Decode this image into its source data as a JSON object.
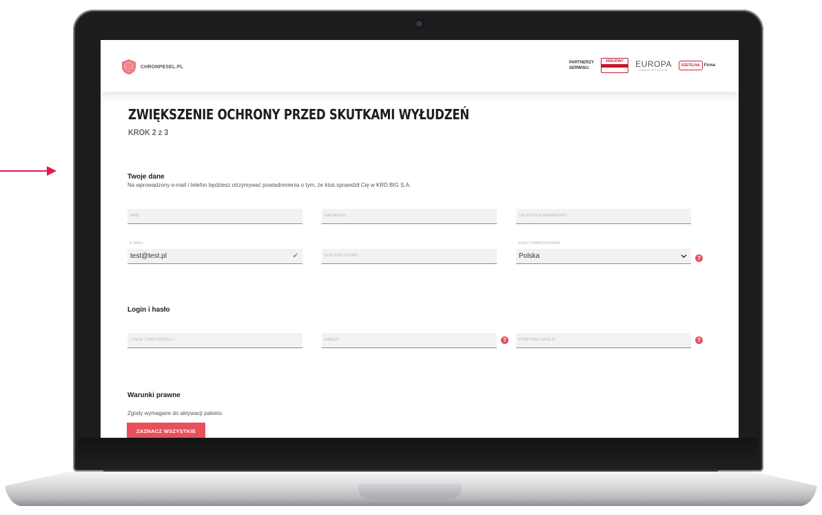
{
  "brand": {
    "name": "CHRONPESEL.PL"
  },
  "partners": {
    "label_line1": "PARTNERZY",
    "label_line2": "SERWISU:",
    "krajowy_top": "KRAJOWY",
    "europa_text": "EUROPA",
    "europa_sub": "UBEZPIECZENIA",
    "rzetelna_text": "RZETELNA",
    "firma_text": "Firma"
  },
  "page": {
    "title": "ZWIĘKSZENIE OCHRONY PRZED SKUTKAMI WYŁUDZEŃ",
    "step": "KROK 2 z 3"
  },
  "personal": {
    "title": "Twoje dane",
    "note": "Na wprowadzony e-mail i telefon będziesz otrzymywać powiadomienia o tym, że ktoś sprawdził Cię w KRD BIG S.A.",
    "first_name_placeholder": "IMIĘ:",
    "last_name_placeholder": "NAZWISKO:",
    "phone_placeholder": "TELEFON KOMÓRKOWY:",
    "email_label": "E-MAIL:",
    "email_value": "test@test.pl",
    "postal_placeholder": "KOD POCZTOWY:",
    "country_label": "KRAJ ZAMIESZKANIA:",
    "country_value": "Polska"
  },
  "login": {
    "title": "Login i hasło",
    "login_placeholder": "LOGIN (TWÓJ PESEL):",
    "password_placeholder": "HASŁO:",
    "repeat_placeholder": "POWTÓRZ HASŁO:"
  },
  "legal": {
    "title": "Warunki prawne",
    "note": "Zgody wymagane do aktywacji pakietu",
    "select_all_label": "ZAZNACZ WSZYSTKIE"
  },
  "colors": {
    "accent": "#e8505b",
    "valid": "#5ba93b",
    "annotation": "#e2194e"
  },
  "icons": {
    "check": "✔",
    "help": "?"
  }
}
